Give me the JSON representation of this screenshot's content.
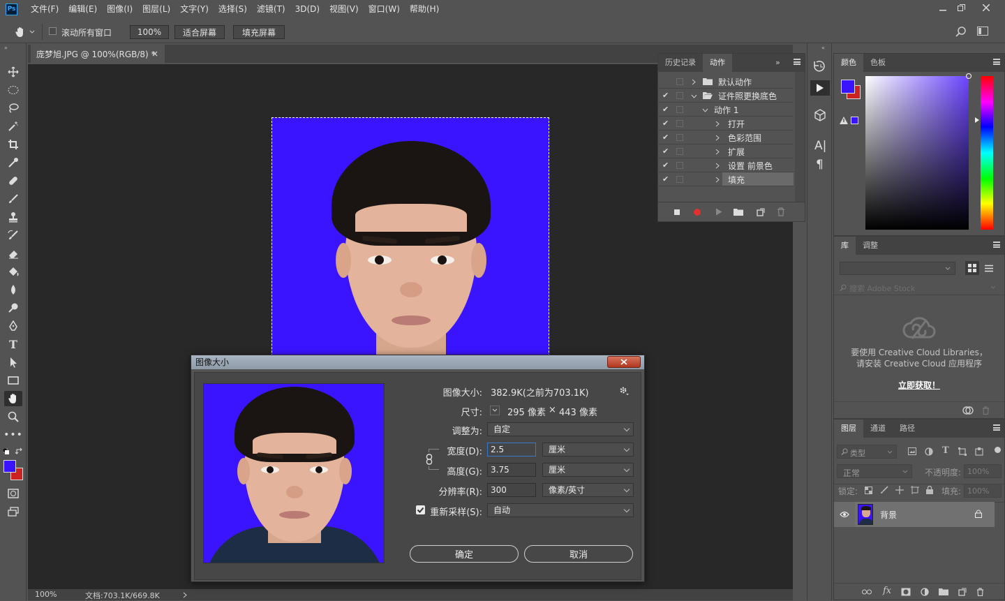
{
  "menubar": {
    "logo": "Ps",
    "items": [
      "文件(F)",
      "编辑(E)",
      "图像(I)",
      "图层(L)",
      "文字(Y)",
      "选择(S)",
      "滤镜(T)",
      "3D(D)",
      "视图(V)",
      "窗口(W)",
      "帮助(H)"
    ]
  },
  "options": {
    "scroll_all_label": "滚动所有窗口",
    "zoom": "100%",
    "fit_screen": "适合屏幕",
    "fill_screen": "填充屏幕"
  },
  "document": {
    "tab_title": "庞梦旭.JPG @ 100%(RGB/8) *",
    "zoom": "100%",
    "doc_info": "文档:703.1K/669.8K",
    "background_color": "#3a13ff"
  },
  "actions_panel": {
    "tabs": [
      "历史记录",
      "动作"
    ],
    "rows": [
      {
        "checked": false,
        "label": "默认动作"
      },
      {
        "checked": true,
        "label": "证件照更换底色"
      },
      {
        "checked": true,
        "label": "动作 1"
      },
      {
        "checked": true,
        "label": "打开"
      },
      {
        "checked": true,
        "label": "色彩范围"
      },
      {
        "checked": true,
        "label": "扩展"
      },
      {
        "checked": true,
        "label": "设置 前景色"
      },
      {
        "checked": true,
        "label": "填充"
      }
    ]
  },
  "color_panel": {
    "tabs": [
      "颜色",
      "色板"
    ],
    "foreground": "#3a13ff",
    "background": "#cc2222"
  },
  "library_panel": {
    "tabs": [
      "库",
      "调整"
    ],
    "search_placeholder": "搜索 Adobe Stock",
    "message_line1": "要使用 Creative Cloud Libraries，",
    "message_line2": "请安装 Creative Cloud 应用程序",
    "get_now": "立即获取！"
  },
  "layers_panel": {
    "tabs": [
      "图层",
      "通道",
      "路径"
    ],
    "filter_label": "类型",
    "blend_mode": "正常",
    "opacity_label": "不透明度:",
    "opacity_value": "100%",
    "lock_label": "锁定:",
    "fill_label": "填充:",
    "fill_value": "100%",
    "layer_name": "背景"
  },
  "dialog": {
    "title": "图像大小",
    "image_size_label": "图像大小:",
    "image_size_value": "382.9K(之前为703.1K)",
    "dimensions_label": "尺寸:",
    "dimensions_width": "295 像素",
    "dimensions_x": "×",
    "dimensions_height": "443 像素",
    "fit_to_label": "调整为:",
    "fit_to_value": "自定",
    "width_label": "宽度(D):",
    "width_value": "2.5",
    "width_unit": "厘米",
    "height_label": "高度(G):",
    "height_value": "3.75",
    "height_unit": "厘米",
    "resolution_label": "分辨率(R):",
    "resolution_value": "300",
    "resolution_unit": "像素/英寸",
    "resample_label": "重新采样(S):",
    "resample_value": "自动",
    "ok": "确定",
    "cancel": "取消"
  }
}
